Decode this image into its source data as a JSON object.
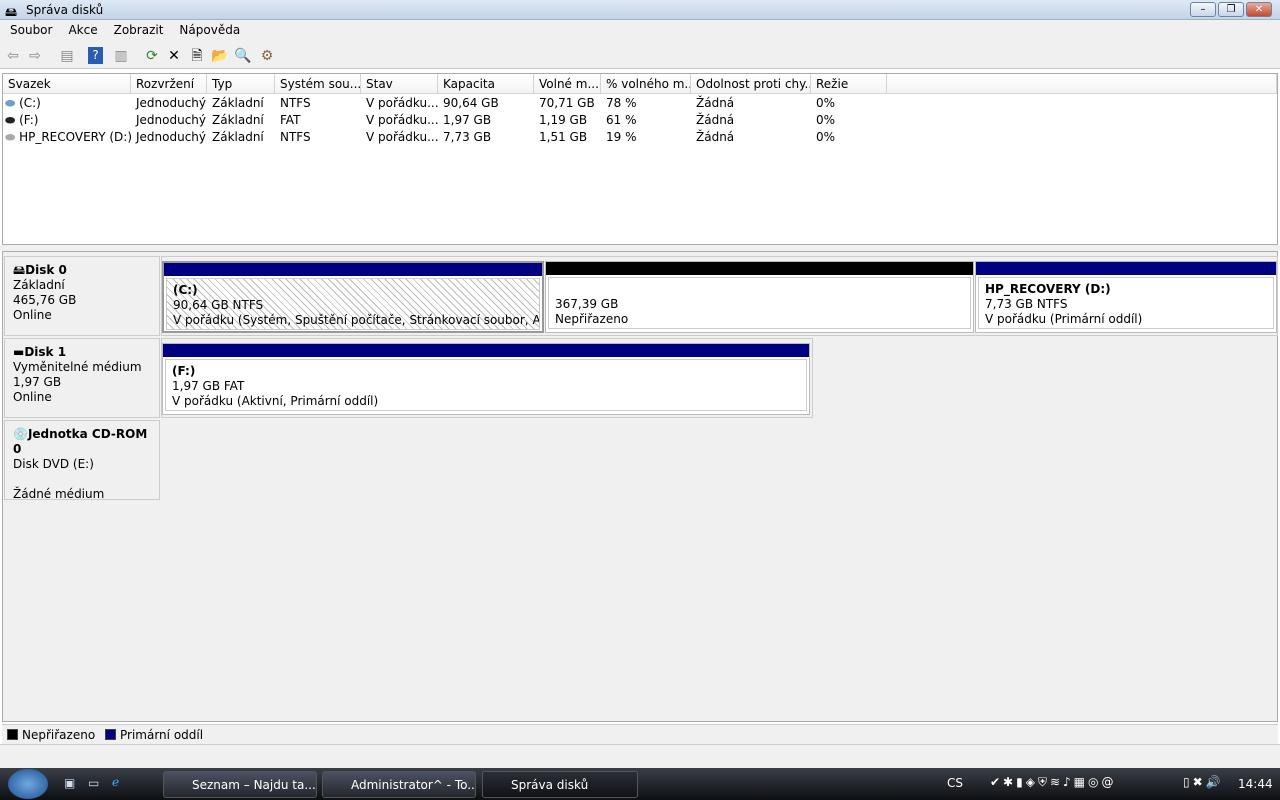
{
  "window": {
    "title": "Správa disků"
  },
  "menu": [
    "Soubor",
    "Akce",
    "Zobrazit",
    "Nápověda"
  ],
  "list": {
    "columns": [
      "Svazek",
      "Rozvržení",
      "Typ",
      "Systém sou...",
      "Stav",
      "Kapacita",
      "Volné m...",
      "% volného m...",
      "Odolnost proti chy...",
      "Režie"
    ],
    "rows": [
      [
        "(C:)",
        "Jednoduchý",
        "Základní",
        "NTFS",
        "V pořádku...",
        "90,64 GB",
        "70,71 GB",
        "78 %",
        "Žádná",
        "0%"
      ],
      [
        "(F:)",
        "Jednoduchý",
        "Základní",
        "FAT",
        "V pořádku...",
        "1,97 GB",
        "1,19 GB",
        "61 %",
        "Žádná",
        "0%"
      ],
      [
        "HP_RECOVERY (D:)",
        "Jednoduchý",
        "Základní",
        "NTFS",
        "V pořádku...",
        "7,73 GB",
        "1,51 GB",
        "19 %",
        "Žádná",
        "0%"
      ]
    ]
  },
  "disks": [
    {
      "name": "Disk 0",
      "type": "Základní",
      "size": "465,76 GB",
      "status": "Online",
      "partitions": [
        {
          "title": "(C:)",
          "size": "90,64 GB NTFS",
          "status": "V pořádku (Systém, Spuštění počítače, Stránkovací soubor, Aktivní, Stav"
        },
        {
          "title": "",
          "size": "367,39 GB",
          "status": "Nepřiřazeno"
        },
        {
          "title": "HP_RECOVERY  (D:)",
          "size": "7,73 GB NTFS",
          "status": "V pořádku (Primární oddíl)"
        }
      ]
    },
    {
      "name": "Disk 1",
      "type": "Vyměnitelné médium",
      "size": "1,97 GB",
      "status": "Online",
      "partitions": [
        {
          "title": "(F:)",
          "size": "1,97 GB FAT",
          "status": "V pořádku (Aktivní, Primární oddíl)"
        }
      ]
    },
    {
      "name": "Jednotka CD-ROM 0",
      "type": "Disk DVD (E:)",
      "status": "Žádné médium"
    }
  ],
  "legend": [
    {
      "label": "Nepřiřazeno",
      "color": "#000000"
    },
    {
      "label": "Primární oddíl",
      "color": "#000080"
    }
  ],
  "taskbar": {
    "tasks": [
      "Seznam – Najdu ta...",
      "Administrator^ - To...",
      "Správa disků"
    ],
    "lang": "CS",
    "clock": "14:44"
  }
}
